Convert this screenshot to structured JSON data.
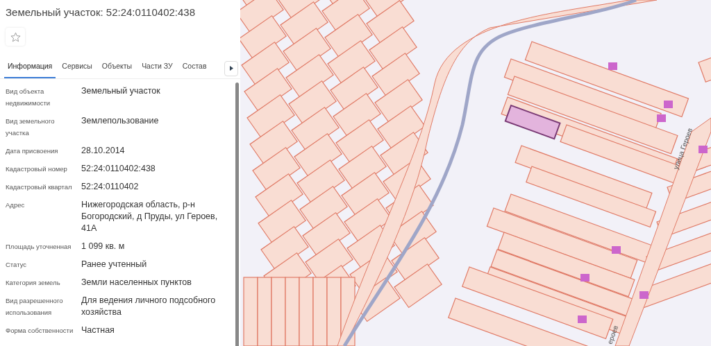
{
  "title": "Земельный участок: 52:24:0110402:438",
  "favorite": {
    "starred": false
  },
  "tabs": [
    {
      "label": "Информация",
      "selected": true
    },
    {
      "label": "Сервисы",
      "selected": false
    },
    {
      "label": "Объекты",
      "selected": false
    },
    {
      "label": "Части ЗУ",
      "selected": false
    },
    {
      "label": "Состав",
      "selected": false
    }
  ],
  "fields": [
    {
      "label": "Вид объекта недвижимости",
      "value": "Земельный участок"
    },
    {
      "label": "Вид земельного участка",
      "value": "Землепользование"
    },
    {
      "label": "Дата присвоения",
      "value": "28.10.2014"
    },
    {
      "label": "Кадастровый номер",
      "value": "52:24:0110402:438"
    },
    {
      "label": "Кадастровый квартал",
      "value": "52:24:0110402"
    },
    {
      "label": "Адрес",
      "value": "Нижегородская область, р-н Богородский, д Пруды, ул Героев, 41А"
    },
    {
      "label": "Площадь уточненная",
      "value": "1 099 кв. м"
    },
    {
      "label": "Статус",
      "value": "Ранее учтенный"
    },
    {
      "label": "Категория земель",
      "value": "Земли населенных пунктов"
    },
    {
      "label": "Вид разрешенного использования",
      "value": "Для ведения личного подсобного хозяйства"
    },
    {
      "label": "Форма собственности",
      "value": "Частная"
    }
  ],
  "map": {
    "street_labels": [
      "улица Героев",
      "ероев"
    ]
  }
}
